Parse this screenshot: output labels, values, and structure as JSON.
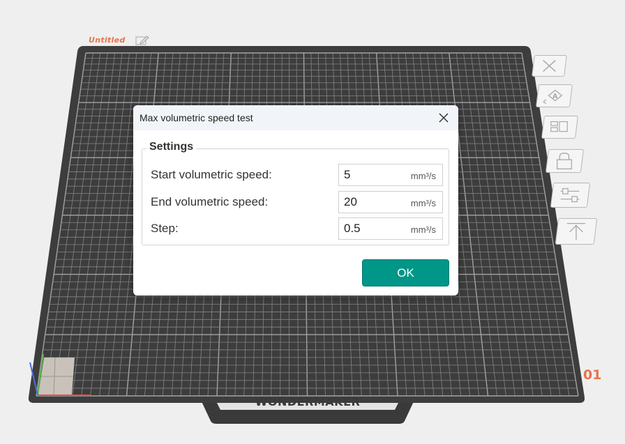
{
  "plate": {
    "name": "Untitled",
    "number": "01",
    "brand": "WONDERMAKER"
  },
  "toolbar": {
    "icons": [
      "delete-all-icon",
      "auto-orient-icon",
      "arrange-icon",
      "lock-icon",
      "plate-settings-icon",
      "move-to-top-icon"
    ]
  },
  "dialog": {
    "title": "Max volumetric speed test",
    "group_title": "Settings",
    "fields": [
      {
        "label": "Start volumetric speed:",
        "value": "5",
        "unit": "mm³/s"
      },
      {
        "label": "End volumetric speed:",
        "value": "20",
        "unit": "mm³/s"
      },
      {
        "label": "Step:",
        "value": "0.5",
        "unit": "mm³/s"
      }
    ],
    "ok_label": "OK"
  },
  "colors": {
    "accent": "#009688",
    "plate": "#3d3d3d",
    "grid": "#8a8a8a",
    "plate_label": "#e8734a"
  }
}
